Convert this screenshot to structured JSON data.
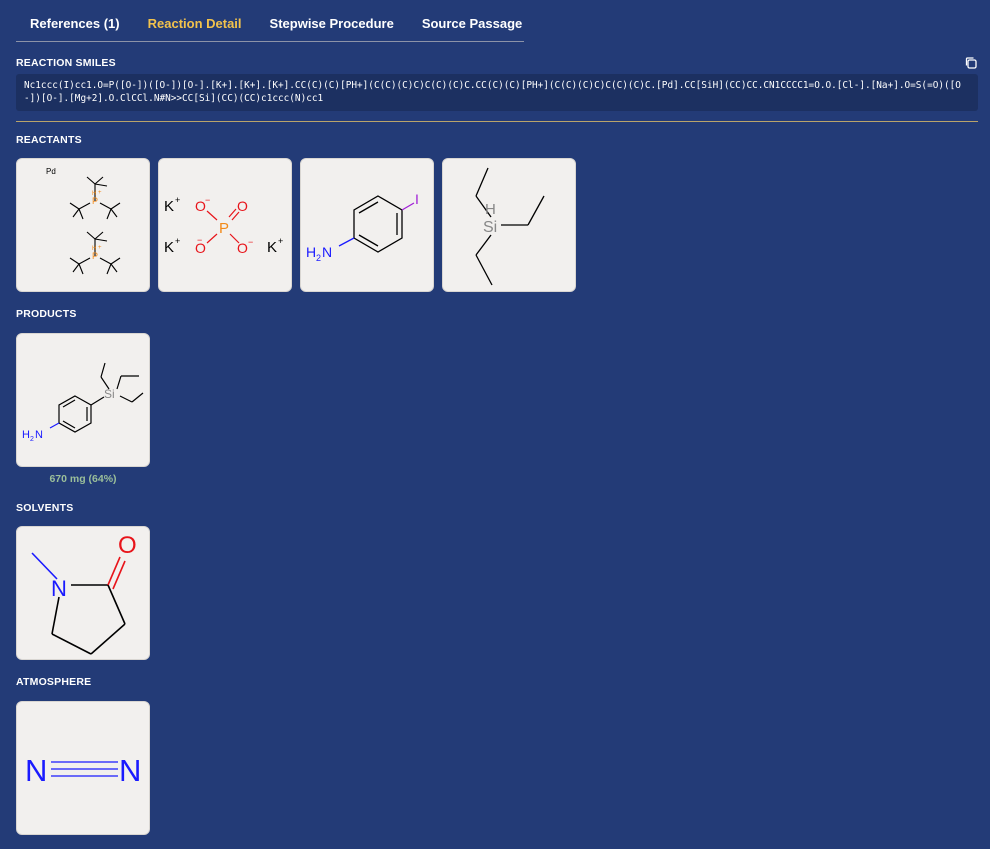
{
  "tabs": [
    {
      "label": "References (1)",
      "active": false
    },
    {
      "label": "Reaction Detail",
      "active": true
    },
    {
      "label": "Stepwise Procedure",
      "active": false
    },
    {
      "label": "Source Passage",
      "active": false
    }
  ],
  "sections": {
    "smiles_label": "REACTION SMILES",
    "reactants_label": "REACTANTS",
    "products_label": "PRODUCTS",
    "solvents_label": "SOLVENTS",
    "atmosphere_label": "ATMOSPHERE"
  },
  "smiles": "Nc1ccc(I)cc1.O=P([O-])([O-])[O-].[K+].[K+].[K+].CC(C)(C)[PH+](C(C)(C)C)C(C)(C)C.CC(C)(C)[PH+](C(C)(C)C)C(C)(C)C.[Pd].CC[SiH](CC)CC.CN1CCCC1=O.O.[Cl-].[Na+].O=S(=O)([O-])[O-].[Mg+2].O.ClCCl.N#N>>CC[Si](CC)(CC)c1ccc(N)cc1",
  "molecule_labels": {
    "pd": "Pd",
    "p": "P",
    "h": "H",
    "plus": "+",
    "k": "K",
    "o": "O",
    "minus": "−",
    "iodine": "I",
    "nh2_n": "N",
    "nh2_h": "H",
    "nh2_2": "2",
    "si": "Si",
    "n": "N"
  },
  "product_yield": "670 mg (64%)",
  "colors": {
    "background": "#233b77",
    "active_tab": "#f2c24c",
    "yield": "#9bbf9a",
    "oxygen": "#e8141a",
    "phosphorus": "#f28a19",
    "nitrogen": "#1a1aff",
    "iodine": "#a01fd6",
    "silicon": "#888888"
  },
  "icons": {
    "copy": "copy-icon"
  }
}
